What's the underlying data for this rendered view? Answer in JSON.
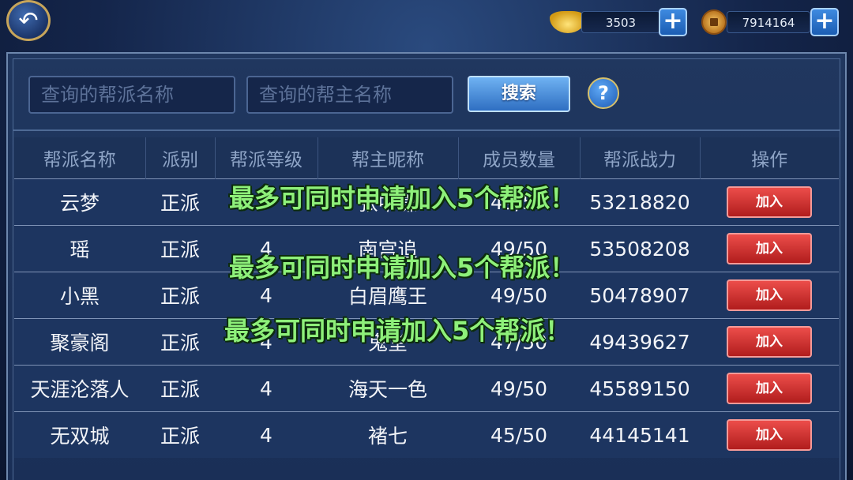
{
  "topbar": {
    "ingot_amount": "3503",
    "coin_amount": "7914164",
    "plus_label": "+",
    "back_icon": "↶"
  },
  "search": {
    "guild_name_placeholder": "查询的帮派名称",
    "leader_name_placeholder": "查询的帮主名称",
    "search_button": "搜索",
    "help_button": "?"
  },
  "table": {
    "headers": [
      "帮派名称",
      "派别",
      "帮派等级",
      "帮主昵称",
      "成员数量",
      "帮派战力",
      "操作"
    ],
    "rows": [
      {
        "name": "云梦",
        "faction": "正派",
        "level": "",
        "leader": "张中谦",
        "members": "49/50",
        "power": "53218820",
        "action": "加入"
      },
      {
        "name": "瑶",
        "faction": "正派",
        "level": "4",
        "leader": "南宫追",
        "members": "49/50",
        "power": "53508208",
        "action": "加入"
      },
      {
        "name": "小黑",
        "faction": "正派",
        "level": "4",
        "leader": "白眉鹰王",
        "members": "49/50",
        "power": "50478907",
        "action": "加入"
      },
      {
        "name": "聚豪阁",
        "faction": "正派",
        "level": "4",
        "leader": "鬼堂",
        "members": "47/50",
        "power": "49439627",
        "action": "加入"
      },
      {
        "name": "天涯沦落人",
        "faction": "正派",
        "level": "4",
        "leader": "海天一色",
        "members": "49/50",
        "power": "45589150",
        "action": "加入"
      },
      {
        "name": "无双城",
        "faction": "正派",
        "level": "4",
        "leader": "褚七",
        "members": "45/50",
        "power": "44145141",
        "action": "加入"
      }
    ]
  },
  "toasts": [
    "最多可同时申请加入5个帮派！",
    "最多可同时申请加入5个帮派！",
    "最多可同时申请加入5个帮派！"
  ],
  "colors": {
    "toast": "#8ef07a",
    "join_button": "#c62a28",
    "search_button": "#3f86d8"
  }
}
